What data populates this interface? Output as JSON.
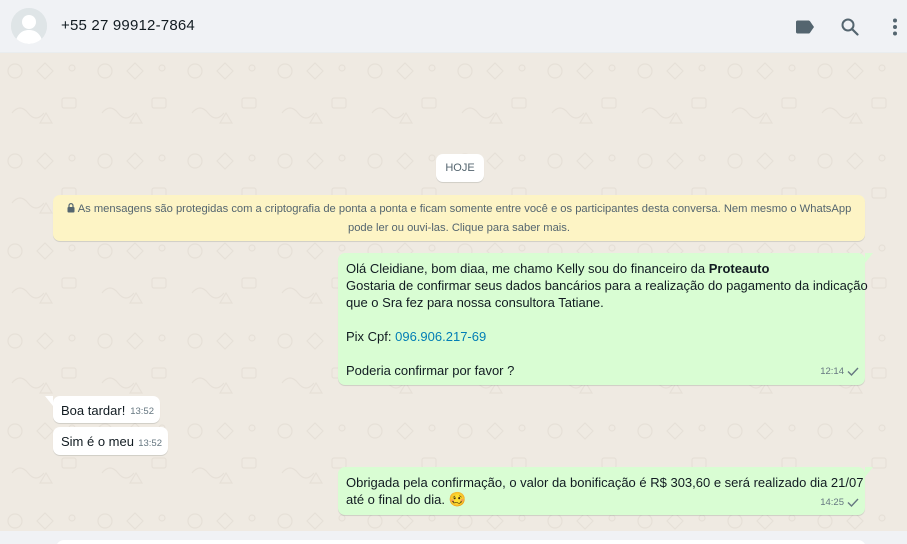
{
  "header": {
    "contact": "+55 27 99912-7864",
    "icons": [
      "avatar-icon",
      "label-icon",
      "search-icon",
      "menu-icon"
    ]
  },
  "chat": {
    "day_label": "HOJE",
    "notice_line1": "As mensagens são protegidas com a criptografia de ponta a ponta e ficam somente entre você e os participantes desta conversa. Nem mesmo o WhatsApp",
    "notice_line2": "pode ler ou ouvi-las. Clique para saber mais.",
    "messages": [
      {
        "direction": "out",
        "line1_prefix": "Olá Cleidiane, bom diaa, me chamo Kelly  sou do financeiro da ",
        "line1_bold": "Proteauto",
        "line2": "Gostaria de confirmar seus dados bancários para a realização do pagamento da indicação",
        "line3": "que o Sra fez para nossa consultora Tatiane.",
        "pix_label": "Pix Cpf: ",
        "pix_value": "096.906.217-69",
        "line5": "Poderia confirmar por favor ?",
        "time": "12:14",
        "status": "sent"
      },
      {
        "direction": "in",
        "text": "Boa tardar!",
        "time": "13:52"
      },
      {
        "direction": "in",
        "text": "Sim é o meu",
        "time": "13:52"
      },
      {
        "direction": "out",
        "line1": "Obrigada pela confirmação, o valor da bonificação é R$ 303,60 e será realizado dia 21/07",
        "line2": "até o final do dia. ",
        "emoji": "🥴",
        "time": "14:25",
        "status": "sent"
      }
    ]
  },
  "colors": {
    "outgoing_bubble": "#d9fdd3",
    "incoming_bubble": "#ffffff",
    "notice_bg": "#fdf4c5",
    "link": "#027eb5",
    "chat_bg": "#efeae2"
  }
}
